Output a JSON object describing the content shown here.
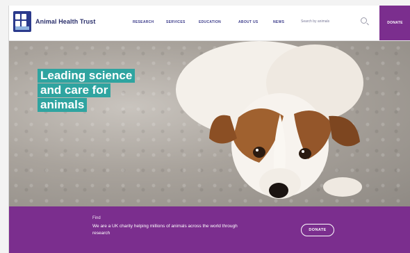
{
  "brand": {
    "name": "Animal Health Trust",
    "logo_icon": "aht-logo-icon"
  },
  "nav": {
    "items": [
      "RESEARCH",
      "SERVICES",
      "EDUCATION",
      "ABOUT US",
      "NEWS"
    ],
    "search_placeholder": "Search by animals",
    "search_icon": "search-icon",
    "donate_label": "DONATE"
  },
  "hero": {
    "headline_lines": [
      "Leading science",
      "and care for",
      "animals"
    ],
    "headline_color": "#2fa4a0"
  },
  "band": {
    "kicker": "Find",
    "text": "We are a UK charity helping millions of animals across the world through research",
    "button_label": "DONATE",
    "color": "#7b2e8e"
  }
}
